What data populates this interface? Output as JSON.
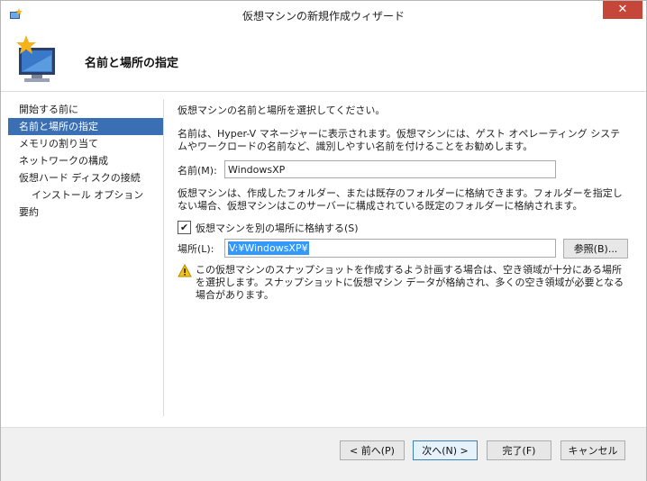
{
  "window": {
    "title": "仮想マシンの新規作成ウィザード",
    "close_glyph": "✕"
  },
  "header": {
    "title": "名前と場所の指定"
  },
  "steps": [
    {
      "label": "開始する前に"
    },
    {
      "label": "名前と場所の指定"
    },
    {
      "label": "メモリの割り当て"
    },
    {
      "label": "ネットワークの構成"
    },
    {
      "label": "仮想ハード ディスクの接続"
    },
    {
      "label": "インストール オプション"
    },
    {
      "label": "要約"
    }
  ],
  "content": {
    "intro": "仮想マシンの名前と場所を選択してください。",
    "name_help": "名前は、Hyper-V マネージャーに表示されます。仮想マシンには、ゲスト オペレーティング システムやワークロードの名前など、識別しやすい名前を付けることをお勧めします。",
    "name_label": "名前(M):",
    "name_value": "WindowsXP",
    "folder_help": "仮想マシンは、作成したフォルダー、または既存のフォルダーに格納できます。フォルダーを指定しない場合、仮想マシンはこのサーバーに構成されている既定のフォルダーに格納されます。",
    "store_checkbox_label": "仮想マシンを別の場所に格納する(S)",
    "store_checked": true,
    "location_label": "場所(L):",
    "location_value": "V:¥WindowsXP¥",
    "browse_label": "参照(B)...",
    "warning_text": "この仮想マシンのスナップショットを作成するよう計画する場合は、空き領域が十分にある場所を選択します。スナップショットに仮想マシン データが格納され、多くの空き領域が必要となる場合があります。"
  },
  "footer": {
    "back_label": "< 前へ(P)",
    "next_label": "次へ(N) >",
    "finish_label": "完了(F)",
    "cancel_label": "キャンセル"
  }
}
